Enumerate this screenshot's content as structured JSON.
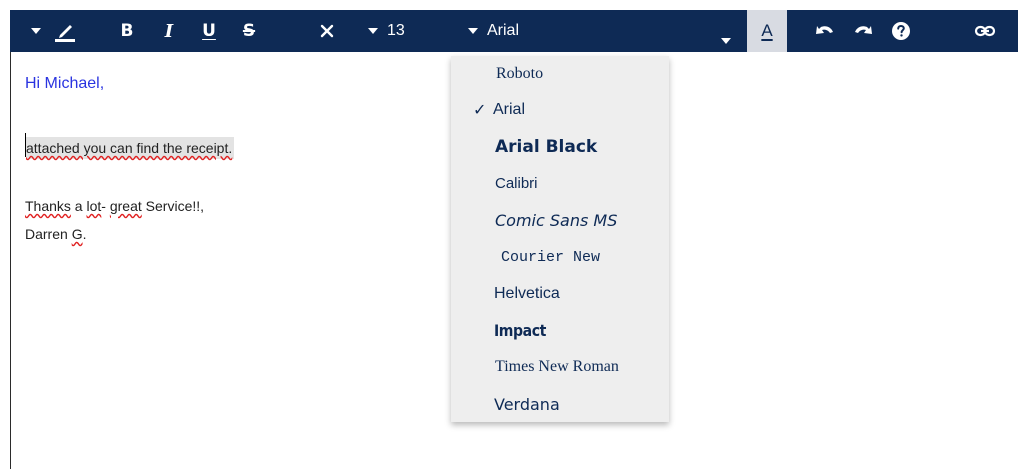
{
  "toolbar": {
    "font_size_value": "13",
    "font_family_value": "Arial",
    "bold_label": "B",
    "italic_label": "I",
    "underline_label": "U",
    "strikethrough_label": "S",
    "text_color_label": "A",
    "accent_color": "#0e2a55",
    "active_button_bg": "#d8dbe2",
    "icons": [
      "caret-down-icon",
      "pen-icon",
      "close-icon",
      "undo-icon",
      "redo-icon",
      "help-icon",
      "link-icon"
    ]
  },
  "editor": {
    "greeting": "Hi Michael,",
    "line1": "attached you can find the receipt.",
    "line2_part1": "Thanks",
    "line2_part2": " a ",
    "line2_part3": "lot",
    "line2_part4": "- ",
    "line2_part5": "great",
    "line2_part6": " Service!!,",
    "line3_part1": "Darren ",
    "line3_part2": "G",
    "line3_part3": ".",
    "greeting_color": "#2a34e0"
  },
  "font_menu": {
    "selected": "Arial",
    "items": [
      {
        "label": "Roboto"
      },
      {
        "label": "Arial"
      },
      {
        "label": "Arial Black"
      },
      {
        "label": "Calibri"
      },
      {
        "label": "Comic Sans MS"
      },
      {
        "label": "Courier New"
      },
      {
        "label": "Helvetica"
      },
      {
        "label": "Impact"
      },
      {
        "label": "Times New Roman"
      },
      {
        "label": "Verdana"
      }
    ]
  }
}
